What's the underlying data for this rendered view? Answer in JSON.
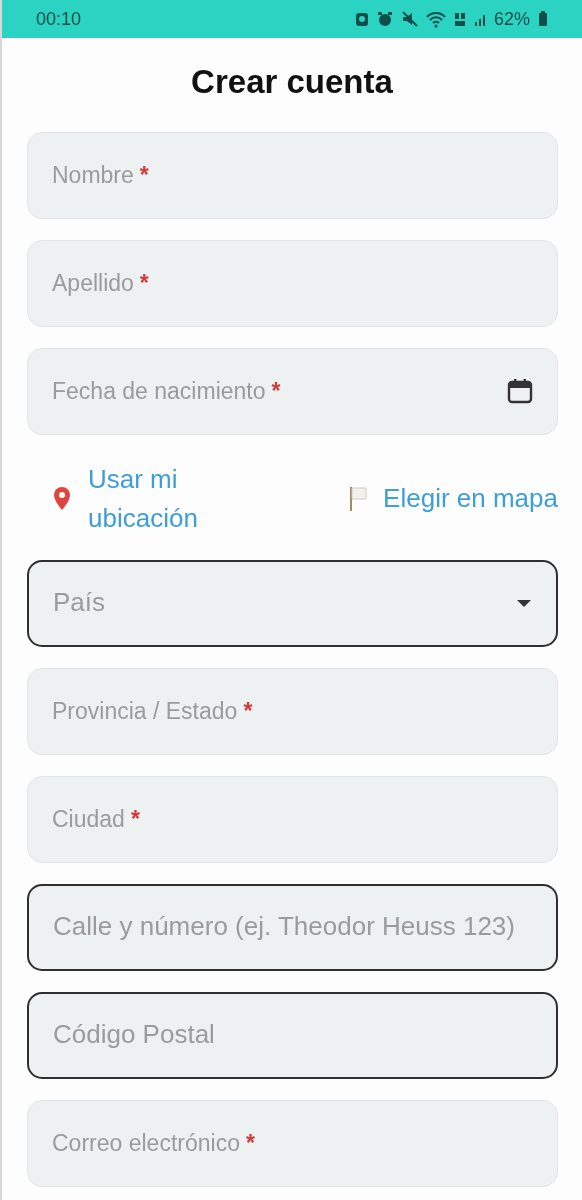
{
  "status_bar": {
    "time": "00:10",
    "battery": "62%"
  },
  "title": "Crear cuenta",
  "fields_top": [
    {
      "kind": "text",
      "placeholder": "Nombre",
      "required_mark": "*",
      "outlined": false
    },
    {
      "kind": "text",
      "placeholder": "Apellido",
      "required_mark": "*",
      "outlined": false
    },
    {
      "kind": "date",
      "placeholder": "Fecha de nacimiento",
      "required_mark": "*",
      "outlined": false
    }
  ],
  "location_actions": [
    {
      "kind": "pin",
      "label": "Usar mi ubicación"
    },
    {
      "kind": "flag",
      "label": "Elegir en mapa"
    }
  ],
  "fields_bottom": [
    {
      "kind": "select",
      "placeholder": "País",
      "outlined": true
    },
    {
      "kind": "text",
      "placeholder": "Provincia / Estado",
      "required_mark": "*",
      "outlined": false
    },
    {
      "kind": "text",
      "placeholder": "Ciudad",
      "required_mark": "*",
      "outlined": false
    },
    {
      "kind": "text",
      "placeholder": "Calle y número (ej. Theodor Heuss 123)",
      "outlined": true
    },
    {
      "kind": "text",
      "placeholder": "Código Postal",
      "outlined": true
    },
    {
      "kind": "text",
      "placeholder": "Correo electrónico",
      "required_mark": "*",
      "outlined": false
    }
  ]
}
